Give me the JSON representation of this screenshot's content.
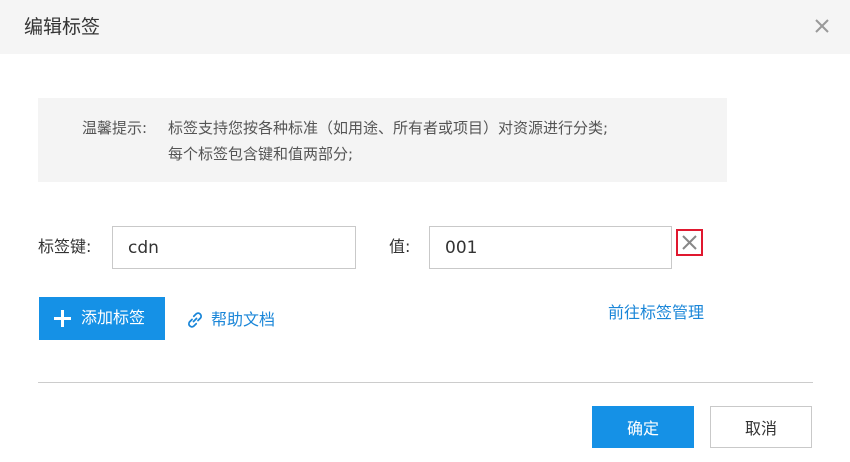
{
  "dialog": {
    "title": "编辑标签",
    "close_icon": "close-icon"
  },
  "tip": {
    "label": "温馨提示:",
    "lines": [
      "标签支持您按各种标准（如用途、所有者或项目）对资源进行分类;",
      "每个标签包含键和值两部分;"
    ]
  },
  "tag_row": {
    "key_label": "标签键:",
    "key_value": "cdn",
    "value_label": "值:",
    "value_value": "001",
    "remove_icon": "close-icon"
  },
  "actions": {
    "add_label": "添加标签",
    "add_icon": "plus-icon",
    "help_label": "帮助文档",
    "help_icon": "link-icon",
    "manage_label": "前往标签管理"
  },
  "footer": {
    "ok_label": "确定",
    "cancel_label": "取消"
  },
  "colors": {
    "primary": "#1591e6",
    "link": "#1a86d8",
    "highlight_border": "#e0182f"
  }
}
